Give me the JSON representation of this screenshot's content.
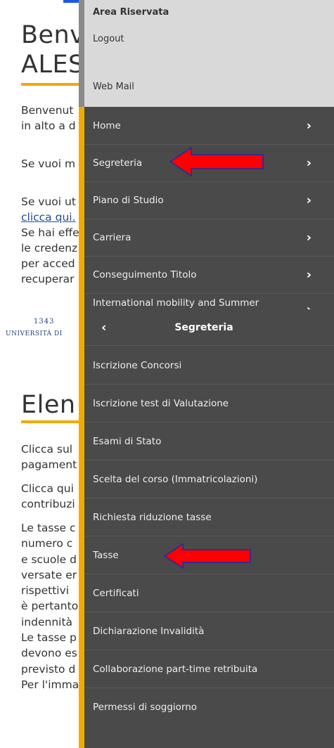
{
  "top_panel": {
    "background": {
      "title_lines": [
        "Benv",
        "ALES"
      ],
      "paragraphs": [
        [
          "Benvenut",
          "in alto a d"
        ],
        [
          "Se vuoi m"
        ],
        [
          "Se vuoi ut",
          "clicca qui.",
          "Se hai effe",
          "le credenz",
          "per acced",
          "recuperar"
        ]
      ]
    },
    "drawer": {
      "area_title": "Area Riservata",
      "logout": "Logout",
      "webmail": "Web Mail",
      "items": [
        {
          "label": "Home",
          "chevron": "›"
        },
        {
          "label": "Segreteria",
          "chevron": "›"
        },
        {
          "label": "Piano di Studio",
          "chevron": "›"
        },
        {
          "label": "Carriera",
          "chevron": "›"
        },
        {
          "label": "Conseguimento Titolo",
          "chevron": "›"
        },
        {
          "label": "International mobility and Summer School",
          "chevron": "›"
        }
      ]
    }
  },
  "bottom_panel": {
    "background": {
      "logo_seal": "1343",
      "logo_name": "UNIVERSITÀ DI",
      "title": "Elen",
      "paragraphs": [
        [
          "Clicca sul",
          "pagament"
        ],
        [
          "Clicca qui",
          "contribuzi"
        ],
        [
          "Le tasse c",
          "numero c",
          "e scuole d",
          "versate er",
          "rispettivi",
          "è pertanto",
          "indennità",
          "Le tasse p",
          "devono es",
          "previsto d",
          "Per l'imma"
        ]
      ]
    },
    "drawer": {
      "back_icon": "‹",
      "title": "Segreteria",
      "items": [
        "Iscrizione Concorsi",
        "Iscrizione test di Valutazione",
        "Esami di Stato",
        "Scelta del corso (Immatricolazioni)",
        "Richiesta riduzione tasse",
        "Tasse",
        "Certificati",
        "Dichiarazione Invalidità",
        "Collaborazione part-time retribuita",
        "Permessi di soggiorno"
      ]
    }
  },
  "colors": {
    "accent": "#f2a900",
    "drawer": "#4a4a4a",
    "arrow": "#ff0000",
    "arrow_outline": "#1a2ba8"
  }
}
